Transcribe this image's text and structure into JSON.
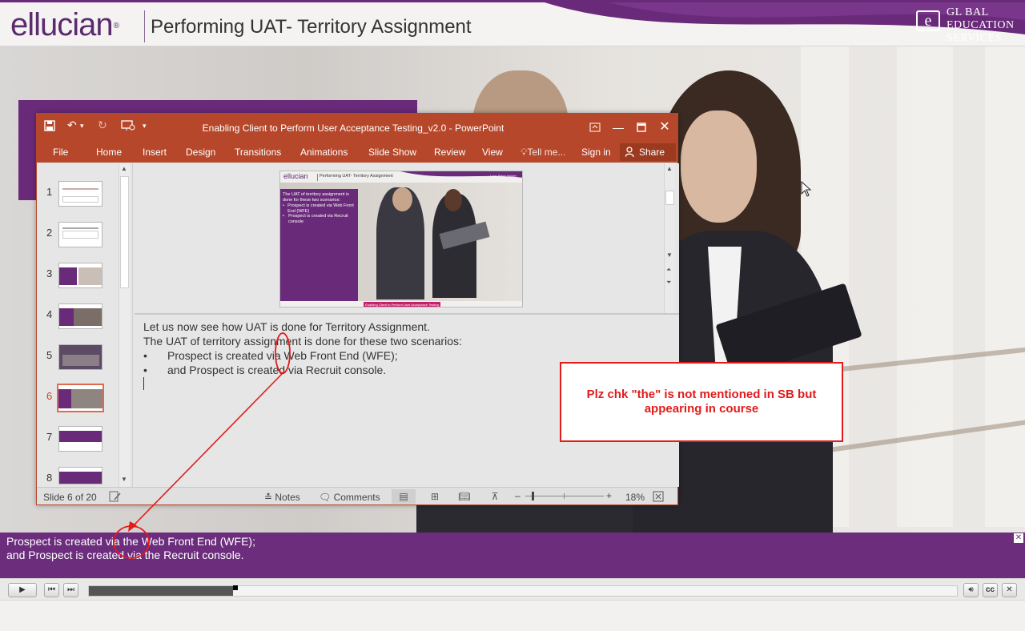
{
  "header": {
    "brand": "ellucian",
    "brand_mark": "®",
    "course_title": "Performing UAT- Territory Assignment",
    "partner_logo": {
      "letter": "e",
      "line1": "GL BAL",
      "line2": "EDUCATION",
      "line3": "SERVICES"
    }
  },
  "ppt": {
    "window_title": "Enabling Client to Perform User Acceptance Testing_v2.0 - PowerPoint",
    "quick_access": [
      "save-icon",
      "undo-icon",
      "redo-icon",
      "present-icon"
    ],
    "window_controls": [
      "ribbon-display-icon",
      "minimize-icon",
      "maximize-icon",
      "close-icon"
    ],
    "tabs": {
      "file": "File",
      "home": "Home",
      "insert": "Insert",
      "design": "Design",
      "transitions": "Transitions",
      "animations": "Animations",
      "slideshow": "Slide Show",
      "review": "Review",
      "view": "View",
      "tellme": "Tell me...",
      "signin": "Sign in",
      "share": "Share"
    },
    "thumbnails": [
      {
        "num": "1",
        "style": "plain"
      },
      {
        "num": "2",
        "style": "plain"
      },
      {
        "num": "3",
        "style": "purple-left"
      },
      {
        "num": "4",
        "style": "purple-photo"
      },
      {
        "num": "5",
        "style": "photo"
      },
      {
        "num": "6",
        "style": "active"
      },
      {
        "num": "7",
        "style": "purple-text"
      },
      {
        "num": "8",
        "style": "purple-list"
      }
    ],
    "preview": {
      "brand": "ellucian",
      "title": "Performing UAT- Territory Assignment",
      "logo_placeholder": "Logo Place Holder",
      "panel_intro": "The UAT of territory assignment is done for these two scenarios:",
      "bullets": [
        "Prospect is created via Web Front End (WFE)",
        "Prospect is created via Recruit console"
      ],
      "footer": "Enabling Client to Perform User Acceptance Testing"
    },
    "notes": {
      "line1": "Let us now see how UAT is done for Territory Assignment.",
      "line2": "The UAT of territory assignment is done for these two scenarios:",
      "bullet_glyph": "•",
      "bullet1": "Prospect is created via Web Front End (WFE);",
      "bullet2": "and Prospect is created via Recruit console."
    },
    "status": {
      "slide_info": "Slide 6 of 20",
      "notes": "Notes",
      "comments": "Comments",
      "zoom": "18%",
      "zoom_minus": "–",
      "zoom_plus": "+",
      "zoom_level": 0.18
    }
  },
  "callout": {
    "text": "Plz chk \"the\" is not mentioned in SB but appearing in course",
    "color": "#e21b1b"
  },
  "caption": {
    "line1": "Prospect is created via the Web Front End (WFE);",
    "line2": "and Prospect is created via the Recruit console."
  },
  "player": {
    "buttons": [
      "play-icon",
      "previous-icon",
      "next-icon",
      "volume-icon",
      "cc-icon",
      "close-icon"
    ],
    "cc_label": "cc",
    "progress": 0.166
  },
  "colors": {
    "brand_purple": "#6c2d7d",
    "ppt_orange": "#b7472a",
    "annotation_red": "#e21b1b"
  }
}
